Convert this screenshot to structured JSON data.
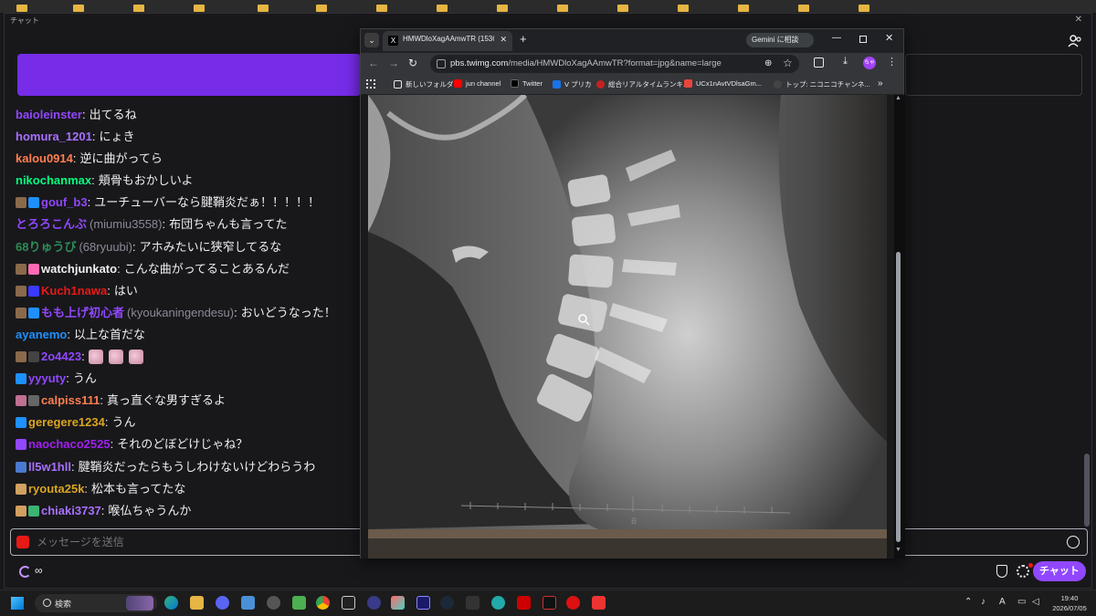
{
  "chat": {
    "window_title": "チャット",
    "close_glyph": "✕",
    "messages": [
      {
        "user": "baioleinster",
        "uid": "",
        "color": "#9147ff",
        "badges": [],
        "text": "出てるね"
      },
      {
        "user": "homura_1201",
        "uid": "",
        "color": "#a970ff",
        "badges": [],
        "text": "にょき"
      },
      {
        "user": "kalou0914",
        "uid": "",
        "color": "#ff7f50",
        "badges": [],
        "text": "逆に曲がってら"
      },
      {
        "user": "nikochanmax",
        "uid": "",
        "color": "#00ff7f",
        "badges": [],
        "text": "頬骨もおかしいよ"
      },
      {
        "user": "gouf_b3",
        "uid": "",
        "color": "#9147ff",
        "badges": [
          "#8a6a4a",
          "#1e90ff"
        ],
        "text": "ユーチューバーなら腱鞘炎だぁ！！！！！"
      },
      {
        "user": "とろろこんぶ",
        "uid": "(miumiu3558)",
        "color": "#9147ff",
        "badges": [],
        "text": "布団ちゃんも言ってた"
      },
      {
        "user": "68りゅうび",
        "uid": "(68ryuubi)",
        "color": "#2e8b57",
        "badges": [],
        "text": "アホみたいに狭窄してるな"
      },
      {
        "user": "watchjunkato",
        "uid": "",
        "color": "#efeff1",
        "badges": [
          "#8a6a4a",
          "#ff69b4"
        ],
        "text": "こんな曲がってることあるんだ"
      },
      {
        "user": "Kuch1nawa",
        "uid": "",
        "color": "#e91916",
        "badges": [
          "#8a6a4a",
          "#3a3aff"
        ],
        "text": "はい"
      },
      {
        "user": "もも上げ初心者",
        "uid": "(kyoukaningendesu)",
        "color": "#9147ff",
        "badges": [
          "#8a6a4a",
          "#1e90ff"
        ],
        "text": "おいどうなった！"
      },
      {
        "user": "ayanemo",
        "uid": "",
        "color": "#1e90ff",
        "badges": [],
        "text": "以上な首だな"
      },
      {
        "user": "2o4423",
        "uid": "",
        "color": "#9147ff",
        "badges": [
          "#8a6a4a",
          "#444"
        ],
        "text": "",
        "emotes": 3
      },
      {
        "user": "yyyuty",
        "uid": "",
        "color": "#9147ff",
        "badges": [
          "#1e90ff"
        ],
        "text": "うん"
      },
      {
        "user": "calpiss111",
        "uid": "",
        "color": "#ff7f50",
        "badges": [
          "#c07090",
          "#666"
        ],
        "text": "真っ直ぐな男すぎるよ"
      },
      {
        "user": "geregere1234",
        "uid": "",
        "color": "#daa520",
        "badges": [
          "#1e90ff"
        ],
        "text": "うん"
      },
      {
        "user": "naochaco2525",
        "uid": "",
        "color": "#a020f0",
        "badges": [
          "#9147ff"
        ],
        "text": "それのどぼどけじゃね？"
      },
      {
        "user": "ll5w1hll",
        "uid": "",
        "color": "#a970ff",
        "badges": [
          "#4a7acf"
        ],
        "text": "腱鞘炎だったらもうしわけないけどわらうわ"
      },
      {
        "user": "ryouta25k",
        "uid": "",
        "color": "#daa520",
        "badges": [
          "#d2a060"
        ],
        "text": "松本も言ってたな"
      },
      {
        "user": "chiaki3737",
        "uid": "",
        "color": "#a970ff",
        "badges": [
          "#d2a060",
          "#3cb371"
        ],
        "text": "喉仏ちゃうんか"
      }
    ],
    "input_placeholder": "メッセージを送信",
    "points_value": "∞",
    "chat_button_label": "チャット"
  },
  "browser": {
    "tab_title": "HMWDloXagAAmwTR (1536×2048)",
    "tab_favicon": "X",
    "gemini_label": "Gemini に相談",
    "url_host": "pbs.twimg.com",
    "url_path": "/media/HMWDloXagAAmwTR?format=jpg&name=large",
    "profile_initials": "ちゃ",
    "bookmarks": [
      {
        "label": "新しいフォルダ",
        "color": "#e8eaed"
      },
      {
        "label": "jun channel",
        "color": "#ff0000"
      },
      {
        "label": "Twitter",
        "color": "#000000"
      },
      {
        "label": "V プリカ",
        "color": "#1a73e8"
      },
      {
        "label": "総合リアルタイムランキ...",
        "color": "#c5221f"
      },
      {
        "label": "UCx1nAvtVDlsaGm...",
        "color": "#e8453c"
      },
      {
        "label": "トップ: ニコニコチャンネ...",
        "color": "#444444"
      }
    ],
    "image_ruler_label": "B"
  },
  "taskbar": {
    "search_label": "検索",
    "time": "19:40",
    "date": "2026/07/05",
    "ime_label": "A"
  }
}
